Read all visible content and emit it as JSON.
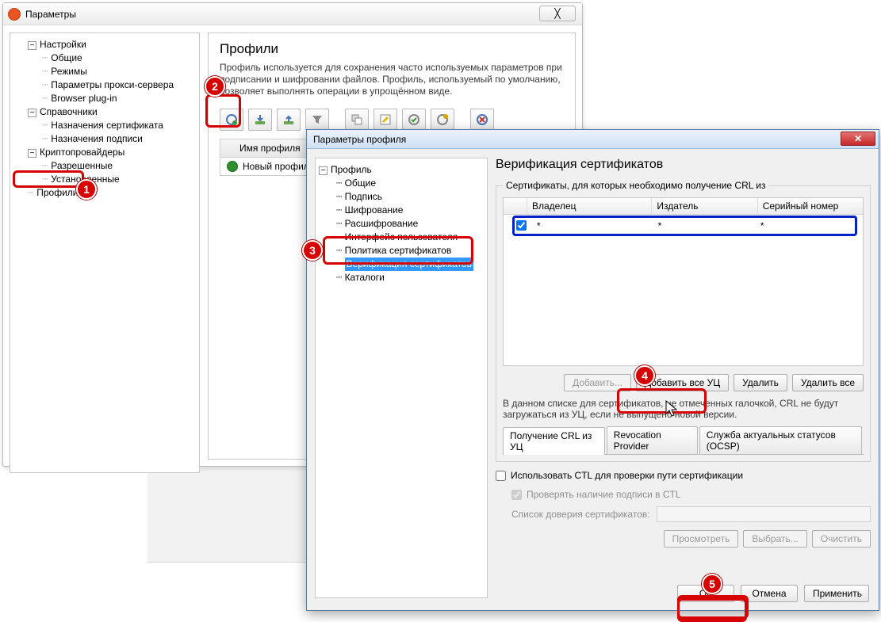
{
  "win1": {
    "title": "Параметры",
    "close_glyph": "╳",
    "tree": {
      "settings": "Настройки",
      "settings_items": [
        "Общие",
        "Режимы",
        "Параметры прокси-сервера",
        "Browser plug-in"
      ],
      "refs": "Справочники",
      "refs_items": [
        "Назначения сертификата",
        "Назначения подписи"
      ],
      "crypto": "Криптопровайдеры",
      "crypto_items": [
        "Разрешенные",
        "Установленные"
      ],
      "profiles": "Профили"
    },
    "content": {
      "heading": "Профили",
      "description": "Профиль используется для сохранения часто используемых параметров при подписании и шифровании файлов. Профиль, используемый по умолчанию, позволяет выполнять операции в упрощённом виде.",
      "col_profile_name": "Имя профиля",
      "row_new_profile": "Новый профиль"
    }
  },
  "win2": {
    "title": "Параметры профиля",
    "tree": {
      "root": "Профиль",
      "items": [
        "Общие",
        "Подпись",
        "Шифрование",
        "Расшифрование",
        "Интерфейс пользователя",
        "Политика сертификатов",
        "Верификация сертификатов",
        "Каталоги"
      ]
    },
    "right": {
      "heading": "Верификация сертификатов",
      "group_legend": "Сертификаты, для которых необходимо получение CRL из",
      "th_owner": "Владелец",
      "th_issuer": "Издатель",
      "th_sn": "Серийный номер",
      "row": {
        "owner": "*",
        "issuer": "*",
        "sn": "*"
      },
      "btn_add": "Добавить...",
      "btn_add_all": "Добавить все УЦ",
      "btn_delete": "Удалить",
      "btn_delete_all": "Удалить все",
      "note": "В данном списке для сертификатов, не отмеченных галочкой, CRL не будут загружаться из УЦ, если не выпущено новой версии.",
      "tab1": "Получение CRL из УЦ",
      "tab2": "Revocation Provider",
      "tab3": "Служба актуальных статусов (OCSP)",
      "chk_ctl": "Использовать CTL для проверки пути сертификации",
      "chk_sig": "Проверять наличие подписи в CTL",
      "lbl_trustlist": "Список доверия сертификатов:",
      "btn_view": "Просмотреть",
      "btn_choose": "Выбрать...",
      "btn_clear": "Очистить"
    },
    "dlg": {
      "ok": "ОК",
      "cancel": "Отмена",
      "apply": "Применить"
    }
  },
  "callouts": {
    "n1": "1",
    "n2": "2",
    "n3": "3",
    "n4": "4",
    "n5": "5"
  }
}
